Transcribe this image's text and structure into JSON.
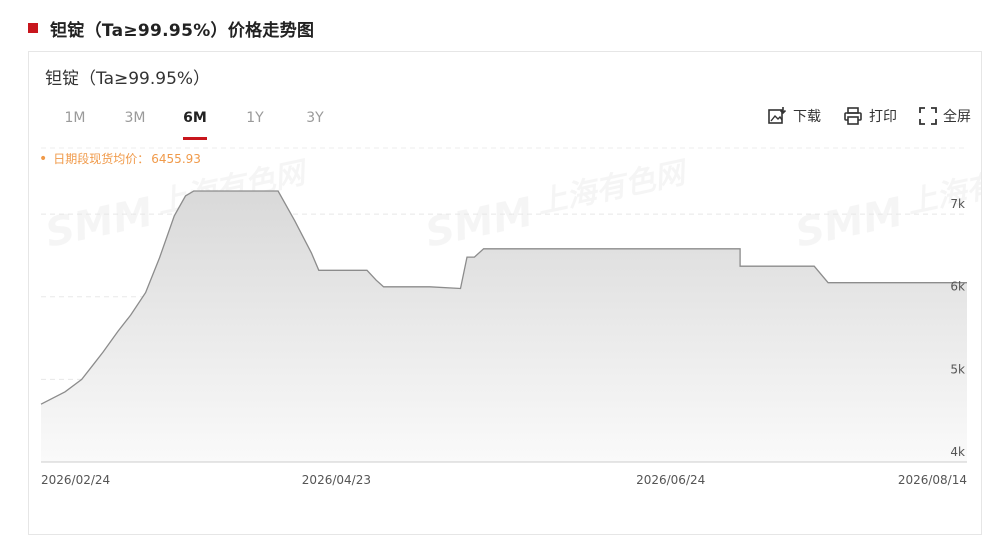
{
  "section": {
    "title": "钽锭（Ta≥99.95%）价格走势图"
  },
  "chart": {
    "title": "钽锭（Ta≥99.95%）",
    "tabs": [
      {
        "label": "1M",
        "active": false
      },
      {
        "label": "3M",
        "active": false
      },
      {
        "label": "6M",
        "active": true
      },
      {
        "label": "1Y",
        "active": false
      },
      {
        "label": "3Y",
        "active": false
      }
    ],
    "tools": [
      {
        "label": "下载",
        "icon": "image-download-icon"
      },
      {
        "label": "打印",
        "icon": "printer-icon"
      },
      {
        "label": "全屏",
        "icon": "fullscreen-icon"
      }
    ],
    "average": {
      "label": "日期段现货均价：",
      "value": "6455.93"
    },
    "watermark": [
      "SMM",
      "上海有色网"
    ]
  },
  "chart_data": {
    "type": "area",
    "x_tick_labels": [
      "2026/02/24",
      "2026/04/23",
      "2026/06/24",
      "2026/08/14"
    ],
    "y_tick_labels": [
      "4k",
      "5k",
      "6k",
      "7k"
    ],
    "ylim": [
      4000,
      7800
    ],
    "y_ticks": [
      4000,
      5000,
      6000,
      7000
    ],
    "grid": "horizontal dashed",
    "colors": {
      "line": "#8c8c8c",
      "fill_top": "#d9d9d9",
      "fill_bottom": "#fafafa"
    },
    "series": [
      {
        "values": [
          4700,
          4850,
          5000,
          5200,
          5330,
          5580,
          5780,
          6050,
          6470,
          6980,
          7220,
          7280,
          7280,
          7280,
          7280,
          7280,
          6920,
          6530,
          6320,
          6320,
          6200,
          6120,
          6120,
          6120,
          6120,
          6100,
          6480,
          6480,
          6580,
          6580,
          6580,
          6580,
          6580,
          6580,
          6580,
          6580,
          6580,
          6580,
          6580,
          6580,
          6580,
          6580,
          6370,
          6370,
          6370,
          6370,
          6370,
          6170,
          6170,
          6170,
          6170,
          6170,
          6170,
          6170,
          6170,
          6170,
          6170,
          6170,
          6170,
          6170,
          6170,
          6170
        ],
        "x_fraction": [
          0,
          0.026,
          0.044,
          0.058,
          0.067,
          0.083,
          0.097,
          0.113,
          0.128,
          0.144,
          0.156,
          0.165,
          0.2,
          0.22,
          0.24,
          0.256,
          0.274,
          0.292,
          0.3,
          0.352,
          0.362,
          0.37,
          0.378,
          0.4,
          0.42,
          0.453,
          0.46,
          0.468,
          0.478,
          0.5,
          0.55,
          0.6,
          0.65,
          0.7,
          0.72,
          0.7,
          0.71,
          0.72,
          0.73,
          0.74,
          0.75,
          0.755,
          0.755,
          0.78,
          0.8,
          0.82,
          0.835,
          0.85,
          0.87,
          0.89,
          0.91,
          0.93,
          0.95,
          0.97,
          0.985,
          0.99,
          0.995,
          0.997,
          0.998,
          0.999,
          1.0,
          1.0
        ]
      }
    ]
  }
}
